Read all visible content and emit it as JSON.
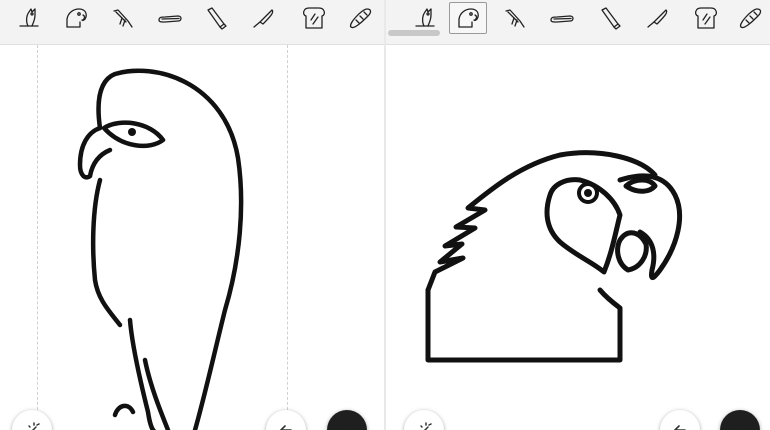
{
  "left_panel": {
    "toolbar": {
      "tools": [
        "owl-icon",
        "parrot-icon",
        "bird-icon",
        "sausage-icon",
        "tube-icon",
        "knife-icon",
        "bread-slice-icon",
        "baguette-icon"
      ],
      "selected": ""
    },
    "drawing": "eagle-drawing"
  },
  "right_panel": {
    "toolbar": {
      "tools": [
        "owl-icon",
        "parrot-icon",
        "bird-icon",
        "sausage-icon",
        "tube-icon",
        "knife-icon",
        "bread-slice-icon",
        "baguette-icon"
      ],
      "selected": "parrot-icon"
    },
    "drawing": "parrot-drawing"
  },
  "colors": {
    "toolbar_bg": "#f3f3f3",
    "ink": "#111111",
    "canvas_bg": "#ffffff"
  },
  "icons": {
    "magic_button": "magic-wand-icon",
    "undo_button": "undo-icon",
    "color_button": "black-dot-icon"
  }
}
